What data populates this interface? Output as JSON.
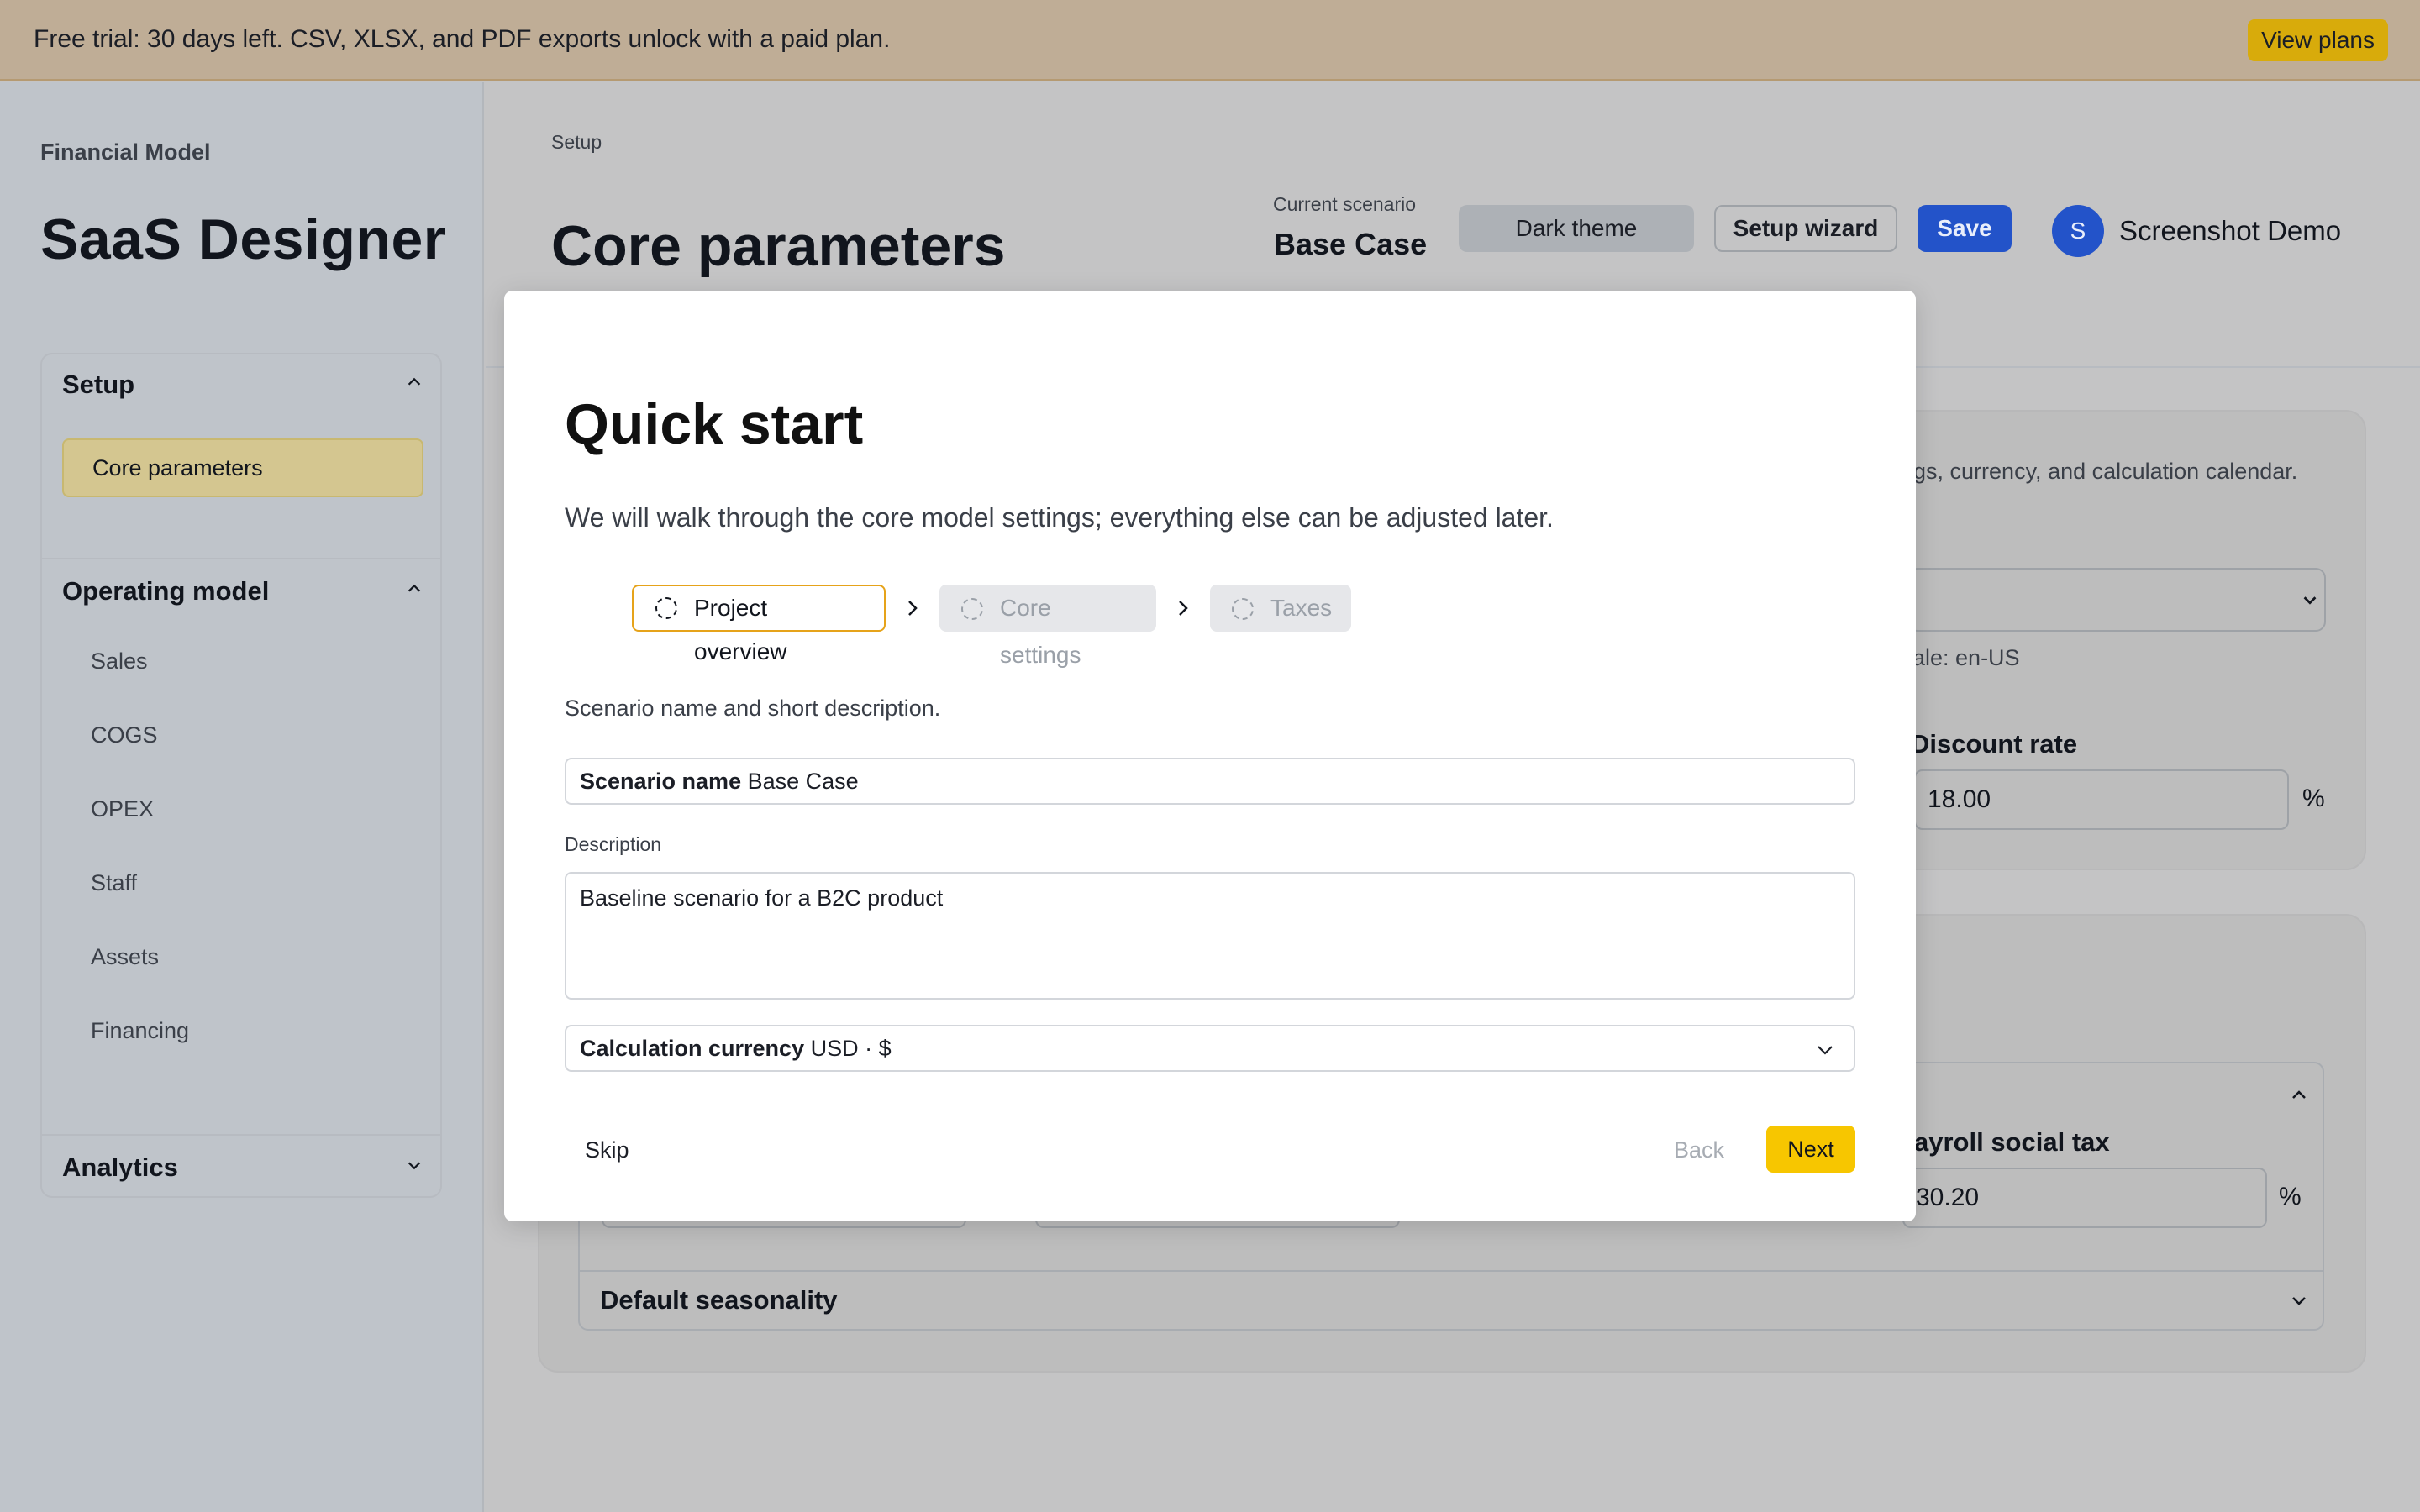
{
  "banner": {
    "text": "Free trial: 30 days left. CSV, XLSX, and PDF exports unlock with a paid plan.",
    "button": "View plans"
  },
  "sidebar": {
    "app_label": "Financial Model",
    "title": "SaaS Designer",
    "sections": [
      {
        "label": "Setup",
        "expanded": true,
        "items": [
          {
            "label": "Core parameters",
            "active": true
          }
        ]
      },
      {
        "label": "Operating model",
        "expanded": true,
        "items": [
          {
            "label": "Sales"
          },
          {
            "label": "COGS"
          },
          {
            "label": "OPEX"
          },
          {
            "label": "Staff"
          },
          {
            "label": "Assets"
          },
          {
            "label": "Financing"
          }
        ]
      },
      {
        "label": "Analytics",
        "expanded": false,
        "items": []
      }
    ]
  },
  "header": {
    "breadcrumb": "Setup",
    "title": "Core parameters",
    "scenario_label": "Current scenario",
    "scenario_value": "Base Case",
    "dark_theme": "Dark theme",
    "setup_wizard": "Setup wizard",
    "save": "Save",
    "avatar_initial": "S",
    "user_name": "Screenshot Demo"
  },
  "background": {
    "card1_text": "ngs, currency, and calculation calendar.",
    "locale_text": "ale: en-US",
    "discount_label": "Discount rate",
    "discount_value": "18.00",
    "pct": "%",
    "payroll_label": "ayroll social tax",
    "payroll_value": "30.20",
    "seasonality_label": "Default seasonality"
  },
  "modal": {
    "title": "Quick start",
    "description": "We will walk through the core model settings; everything else can be adjusted later.",
    "steps": [
      {
        "label": "Project overview",
        "active": true
      },
      {
        "label": "Core settings",
        "active": false
      },
      {
        "label": "Taxes",
        "active": false
      }
    ],
    "subtitle": "Scenario name and short description.",
    "scenario_name_label": "Scenario name",
    "scenario_name_value": "Base Case",
    "description_label": "Description",
    "description_value": "Baseline scenario for a B2C product",
    "currency_label": "Calculation currency",
    "currency_value": "USD · $",
    "skip": "Skip",
    "back": "Back",
    "next": "Next"
  },
  "colors": {
    "banner_bg": "#bfad96",
    "accent_blue": "#2353c9",
    "next_yellow": "#f7c600",
    "active_step_border": "#e6a31a"
  }
}
